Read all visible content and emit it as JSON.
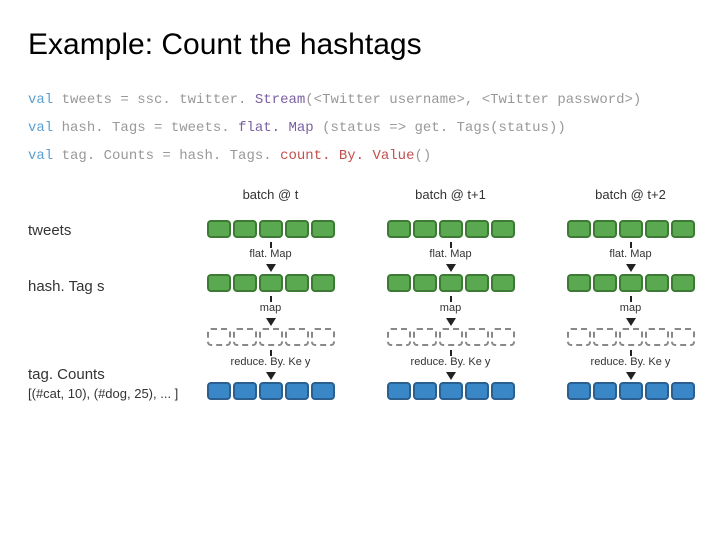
{
  "title": "Example: Count the hashtags",
  "code": {
    "line1": {
      "kw": "val",
      "lhs": " tweets = ssc. twitter. ",
      "method": "Stream",
      "rhs": "(<Twitter username>, <Twitter password>)"
    },
    "line2": {
      "kw": "val",
      "lhs": " hash. Tags = tweets. ",
      "method": "flat. Map",
      "rhs": " (status => get. Tags(status))"
    },
    "line3": {
      "kw": "val",
      "lhs": " tag. Counts = hash. Tags. ",
      "method": "count. By. Value",
      "rhs": "()"
    }
  },
  "labels": {
    "tweets": "tweets",
    "hashtags": "hash. Tag s",
    "tagcounts": "tag. Counts",
    "tuples": "[(#cat, 10), (#dog, 25), ... ]"
  },
  "batches": {
    "b1": "batch @ t",
    "b2": "batch @ t+1",
    "b3": "batch @ t+2"
  },
  "ops": {
    "flatmap": "flat. Map",
    "map": "map",
    "reduce": "reduce. By. Ke y"
  },
  "chart_data": {
    "type": "diagram",
    "streams": [
      "tweets",
      "hashTags",
      "tagCounts"
    ],
    "batches": [
      "t",
      "t+1",
      "t+2"
    ],
    "stages": [
      {
        "from": "tweets",
        "to": "hashTags",
        "op": "flatMap"
      },
      {
        "from": "hashTags",
        "to": "intermediate",
        "op": "map"
      },
      {
        "from": "intermediate",
        "to": "tagCounts",
        "op": "reduceByKey"
      }
    ],
    "example_output": "[(#cat, 10), (#dog, 25), ...]"
  }
}
